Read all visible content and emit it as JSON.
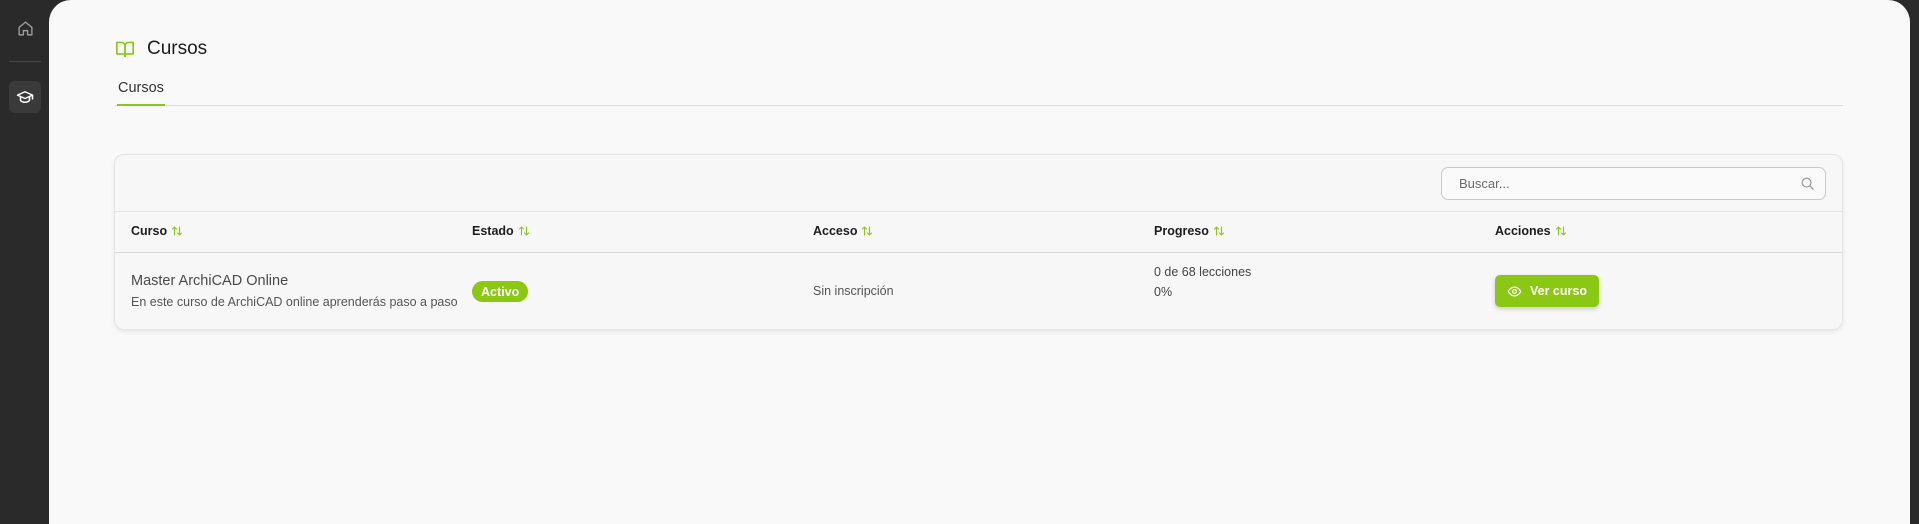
{
  "sidebar": {
    "items": [
      {
        "icon": "home-icon"
      },
      {
        "icon": "graduation-cap-icon",
        "active": true
      }
    ]
  },
  "header": {
    "icon": "book-open-icon",
    "title": "Cursos"
  },
  "tabs": [
    {
      "label": "Cursos",
      "active": true
    }
  ],
  "search": {
    "placeholder": "Buscar...",
    "value": ""
  },
  "table": {
    "columns": [
      {
        "label": "Curso",
        "sortable": true
      },
      {
        "label": "Estado",
        "sortable": true
      },
      {
        "label": "Acceso",
        "sortable": true
      },
      {
        "label": "Progreso",
        "sortable": true
      },
      {
        "label": "Acciones",
        "sortable": true
      }
    ],
    "rows": [
      {
        "title": "Master ArchiCAD Online",
        "description": "En este curso de ArchiCAD online aprenderás paso a paso",
        "status": "Activo",
        "access": "Sin inscripción",
        "progress_lessons": "0 de 68 lecciones",
        "progress_percent": "0%",
        "action_label": "Ver curso"
      }
    ]
  },
  "colors": {
    "accent": "#8bc813",
    "sidebar_bg": "#2a2a2a",
    "page_bg": "#f9f9f9"
  }
}
